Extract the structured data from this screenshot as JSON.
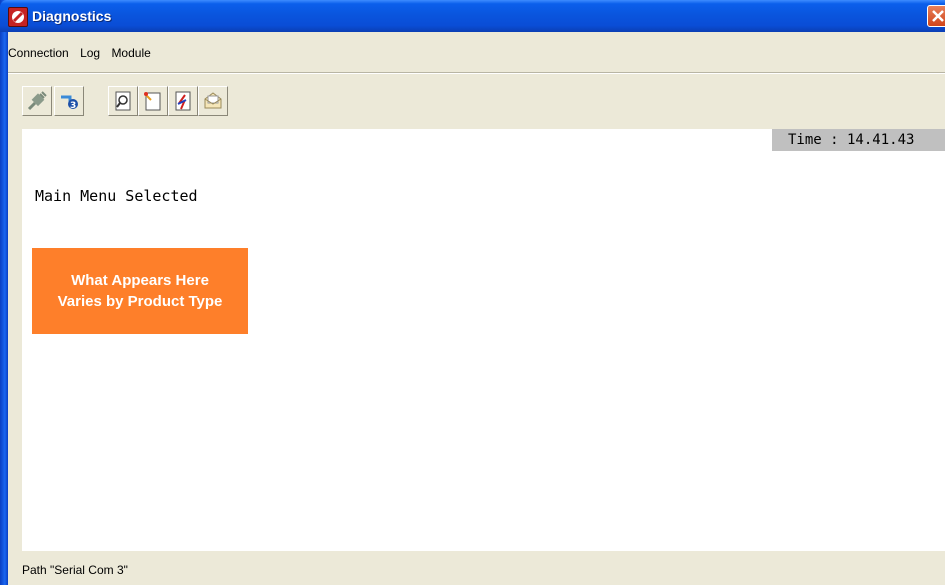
{
  "window": {
    "title": "Diagnostics"
  },
  "menu": {
    "items": [
      "Connection",
      "Log",
      "Module"
    ]
  },
  "toolbar": {
    "buttons": [
      {
        "icon": "disconnect-plug-icon"
      },
      {
        "icon": "connect-icon"
      },
      {
        "icon": "view-log-icon"
      },
      {
        "icon": "new-log-icon"
      },
      {
        "icon": "upload-log-icon"
      },
      {
        "icon": "email-log-icon"
      }
    ]
  },
  "time": {
    "text": "Time : 14.41.43"
  },
  "main": {
    "message": "Main Menu Selected",
    "note_line1": "What Appears Here",
    "note_line2": "Varies by Product Type",
    "note_color": "#FE7F2A"
  },
  "status": {
    "path": "Path \"Serial Com 3\""
  }
}
